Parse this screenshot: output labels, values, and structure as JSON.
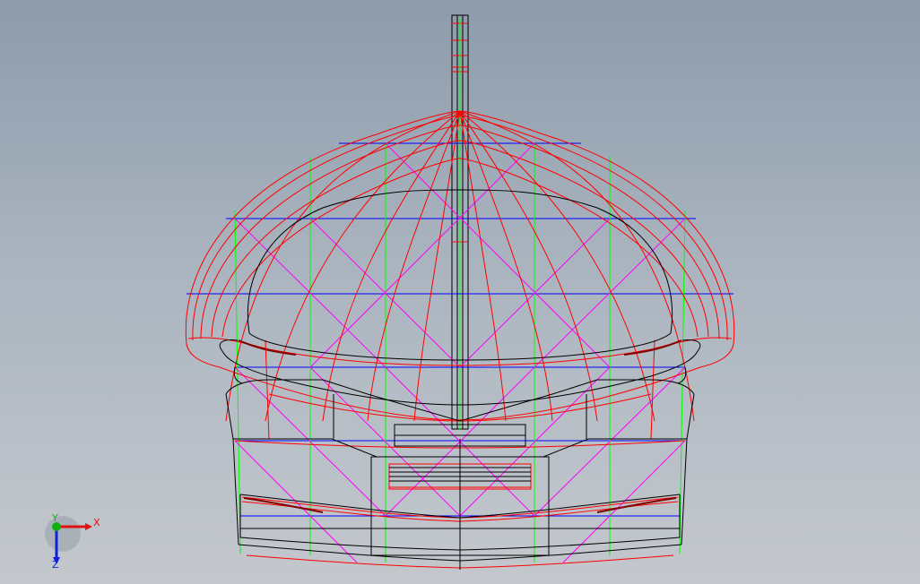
{
  "viewport": {
    "background_top": "#8d9bab",
    "background_bottom": "#c4c8cd"
  },
  "colors": {
    "outline": "#000000",
    "surface_curves": "#ff0000",
    "section_lines": "#0000ff",
    "diagonals": "#ff00ff",
    "verticals": "#00ff00"
  },
  "triad": {
    "x_label": "X",
    "y_label": "Y",
    "z_label": "Z",
    "x_color": "#e01010",
    "y_color": "#10b010",
    "z_color": "#1020e0"
  }
}
